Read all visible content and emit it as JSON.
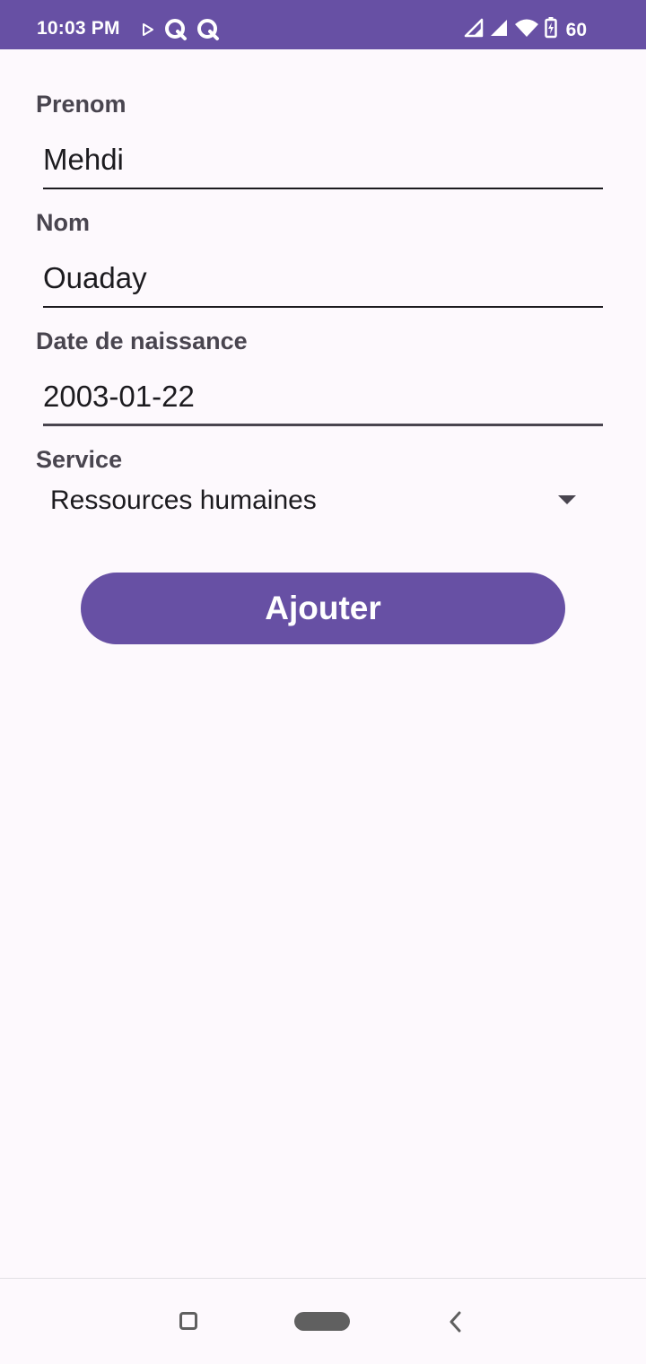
{
  "status_bar": {
    "time": "10:03 PM",
    "battery_level": "60",
    "icons": [
      "play-store-icon",
      "q-app-icon",
      "q-app-icon",
      "signal-icon",
      "signal-icon",
      "wifi-icon",
      "battery-charging-icon"
    ]
  },
  "form": {
    "prenom": {
      "label": "Prenom",
      "value": "Mehdi"
    },
    "nom": {
      "label": "Nom",
      "value": "Ouaday"
    },
    "date_naissance": {
      "label": "Date de naissance",
      "value": "2003-01-22"
    },
    "service": {
      "label": "Service",
      "selected": "Ressources humaines"
    },
    "submit_label": "Ajouter"
  },
  "colors": {
    "primary": "#6750a4",
    "background": "#fdf9fd",
    "label": "#49454f"
  },
  "nav_bar": {
    "icons": [
      "recents-icon",
      "home-pill-icon",
      "back-icon"
    ]
  }
}
